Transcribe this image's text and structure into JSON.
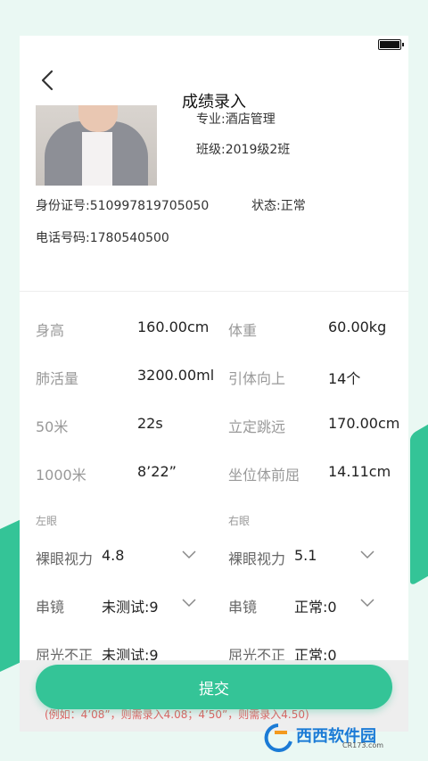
{
  "header": {
    "title": "成绩录入"
  },
  "profile": {
    "major": "专业:酒店管理",
    "class": "班级:2019级2班",
    "id_number": "身份证号:510997819705050",
    "status": "状态:正常",
    "phone": "电话号码:1780540500"
  },
  "metrics": [
    {
      "label": "身高",
      "value": "160.00cm"
    },
    {
      "label": "体重",
      "value": "60.00kg"
    },
    {
      "label": "肺活量",
      "value": "3200.00ml"
    },
    {
      "label": "引体向上",
      "value": "14个"
    },
    {
      "label": "50米",
      "value": "22s"
    },
    {
      "label": "立定跳远",
      "value": "170.00cm"
    },
    {
      "label": "1000米",
      "value": "8’22”"
    },
    {
      "label": "坐位体前屈",
      "value": "14.11cm"
    }
  ],
  "eyes": {
    "left": {
      "title": "左眼",
      "naked_label": "裸眼视力",
      "naked_value": "4.8",
      "chuanjing_label": "串镜",
      "chuanjing_value": "未测试:9",
      "qguang_label": "屈光不正",
      "qguang_value": "未测试:9"
    },
    "right": {
      "title": "右眼",
      "naked_label": "裸眼视力",
      "naked_value": "5.1",
      "chuanjing_label": "串镜",
      "chuanjing_value": "正常:0",
      "qguang_label": "屈光不正",
      "qguang_value": "正常:0"
    }
  },
  "actions": {
    "submit_label": "提交"
  },
  "hint": "(例如：4’08”，则需录入4.08；4’50”，则需录入4.50)",
  "watermark": {
    "text": "西西软件园",
    "sub": "CR173.com"
  },
  "colors": {
    "accent": "#34c497",
    "hint": "#e06060"
  }
}
